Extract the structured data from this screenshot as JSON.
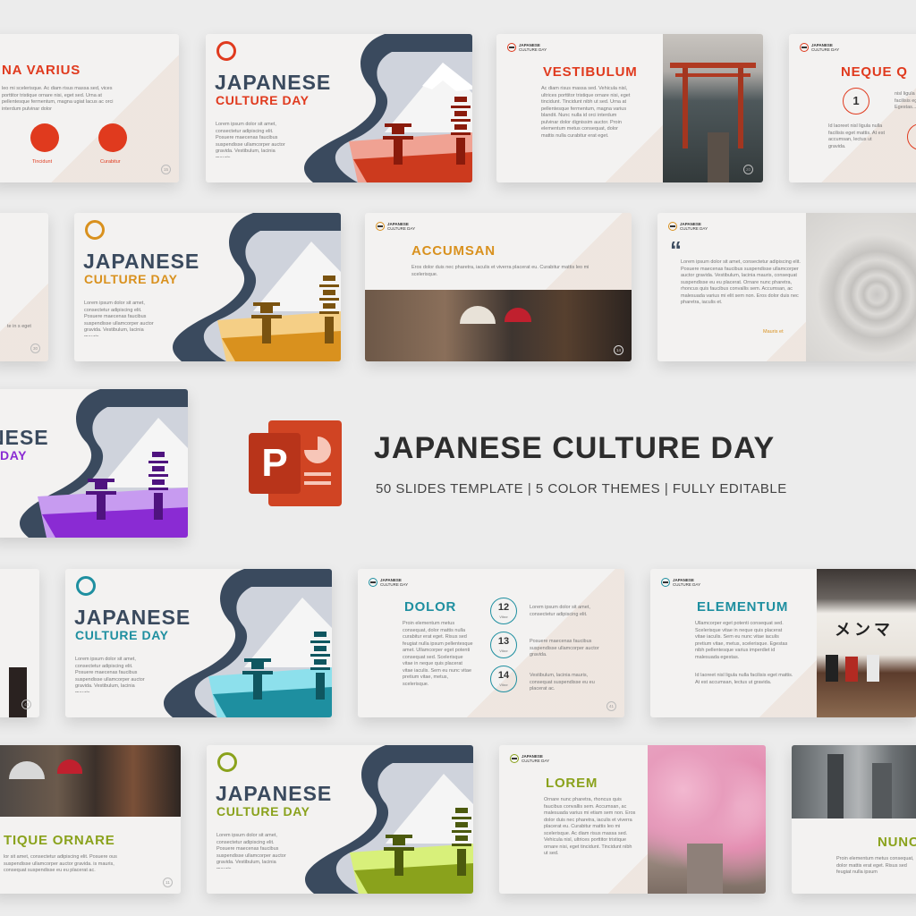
{
  "headline": {
    "title": "JAPANESE CULTURE DAY",
    "subtitle": "50 SLIDES TEMPLATE | 5 COLOR THEMES | FULLY EDITABLE"
  },
  "icon": {
    "name": "powerpoint-icon",
    "color": "#d04423",
    "letter": "P"
  },
  "palette": {
    "red": "#e03a1e",
    "orange": "#d9911e",
    "purple": "#8a2bd3",
    "teal": "#1e8fa0",
    "green": "#8aa21c",
    "navy": "#3a4a5e"
  },
  "brand": {
    "line1": "JAPANESE",
    "line2": "CULTURE DAY"
  },
  "cover": {
    "title": "JAPANESE",
    "subtitle": "CULTURE DAY",
    "body": "Lorem ipsum dolor sit amet, consectetur adipiscing elit. Posuere maecenas faucibus suspendisse ullamcorper auctor gravida. Vestibulum, lacinia mauris."
  },
  "slides": {
    "r1a": {
      "title": "NA VARIUS",
      "body": "leo mi scelerisque. Ac diam risus massa sed, vices porttitor tristique ornare nisi, eget sed. Urna at pellentesque fermentum, magna ugiat lacus ac orci interdum pulvinar dolor",
      "label1": "Tincidunt",
      "label2": "Curabitur",
      "num": "15"
    },
    "r1c": {
      "title": "VESTIBULUM",
      "body": "Ac diam risus massa sed. Vehicula nisl, ultrices porttitor tristique ornare nisi, eget tincidunt. Tincidunt nibh ut sed. Urna at pellentesque fermentum, magna varius blandit. Nunc nulla id orci interdum pulvinar dolor dignissim auctor. Proin elementum metus consequat, dolor mattis nulla curabitur erat eget.",
      "num": "20"
    },
    "r1d": {
      "title": "NEQUE Q",
      "circle": "1",
      "body": "Id laoreet nisl ligula nulla facilisis eget mattis. At est accumsan, lectus ut gravida.",
      "body2": "nisl ligula facilisis eget Egestas..."
    },
    "r2a": {
      "body": "te in s eget",
      "num": "30"
    },
    "r2c": {
      "title": "ACCUMSAN",
      "body": "Eros dolor duis nec pharetra, iaculis et viverra placerat eu. Curabitur mattis leo mi scelerisque.",
      "num": "14"
    },
    "r2d": {
      "quote": "“",
      "body": "Lorem ipsum dolor sit amet, consectetur adipiscing elit. Posuere maecenas faucibus suspendisse ullamcorper auctor gravida. Vestibulum, lacinia mauris, consequat suspendisse eu eu placerat. Ornare nunc pharetra, rhoncus quis faucibus convallis sem. Accumsan, ac malesuada varius mi elit sem non. Eros dolor duis nec pharetra, iaculis et.",
      "author": "Mauris et"
    },
    "r3a": {
      "title": "NESE",
      "subtitle": "DAY"
    },
    "r4a": {
      "num": "44"
    },
    "r4c": {
      "title": "DOLOR",
      "body": "Proin elementum metus consequat, dolor mattis nulla curabitur erat eget. Risus sed feugiat nulla ipsum pellentesque amet. Ullamcorper eget potenti consequat sed. Scelerisque vitae in neque quis placerat vitae iaculis. Sem eu nunc vitae pretium vitae, metus, scelerisque.",
      "items": [
        {
          "n": "12",
          "u": "Vitae",
          "t": "Lorem ipsum dolor sit amet, consectetur adipiscing elit."
        },
        {
          "n": "13",
          "u": "Vitae",
          "t": "Posuere maecenas faucibus suspendisse ullamcorper auctor gravida."
        },
        {
          "n": "14",
          "u": "Vitae",
          "t": "Vestibulum, lacinia mauris, consequat suspendisse eu eu placerat ac."
        }
      ],
      "num": "41"
    },
    "r4d": {
      "title": "ELEMENTUM",
      "body": "Ullamcorper eget potenti consequat sed. Scelerisque vitae in neque quis placerat vitae iaculis. Sem eu nunc vitae iaculis pretium vitae, metus, scelerisque. Egestas nibh pellentesque varius imperdiet id malesuada egestas.",
      "body2": "Id laoreet nisl ligula nulla facilisis eget mattis. At est accumsan, lectus ut gravida.",
      "sign": "メンマ"
    },
    "r5a": {
      "title": "TIQUE ORNARE",
      "body": "lor sit amet, consectetur adipiscing elit. Posuere ous suspendisse ullamcorper auctor gravida. is mauris, consequat suspendisse eu eu placerat ac.",
      "num": "11"
    },
    "r5c": {
      "title": "LOREM",
      "body": "Ornare nunc pharetra, rhoncus quis faucibus convallis sem. Accumsan, ac malesuada varius mi etiam sem non. Eros dolor duis nec pharetra, iaculis et viverra placerat eu. Curabitur mattis leo mi scelerisque. Ac diam risus massa sed. Vehicula nisl, ultrices porttitor tristique ornare nisi, eget tincidunt. Tincidunt nibh ut sed."
    },
    "r5d": {
      "title": "NUNC",
      "body": "Proin elementum metus consequat, dolor mattis erat eget. Risus sed feugiat nulla ipsum"
    }
  }
}
